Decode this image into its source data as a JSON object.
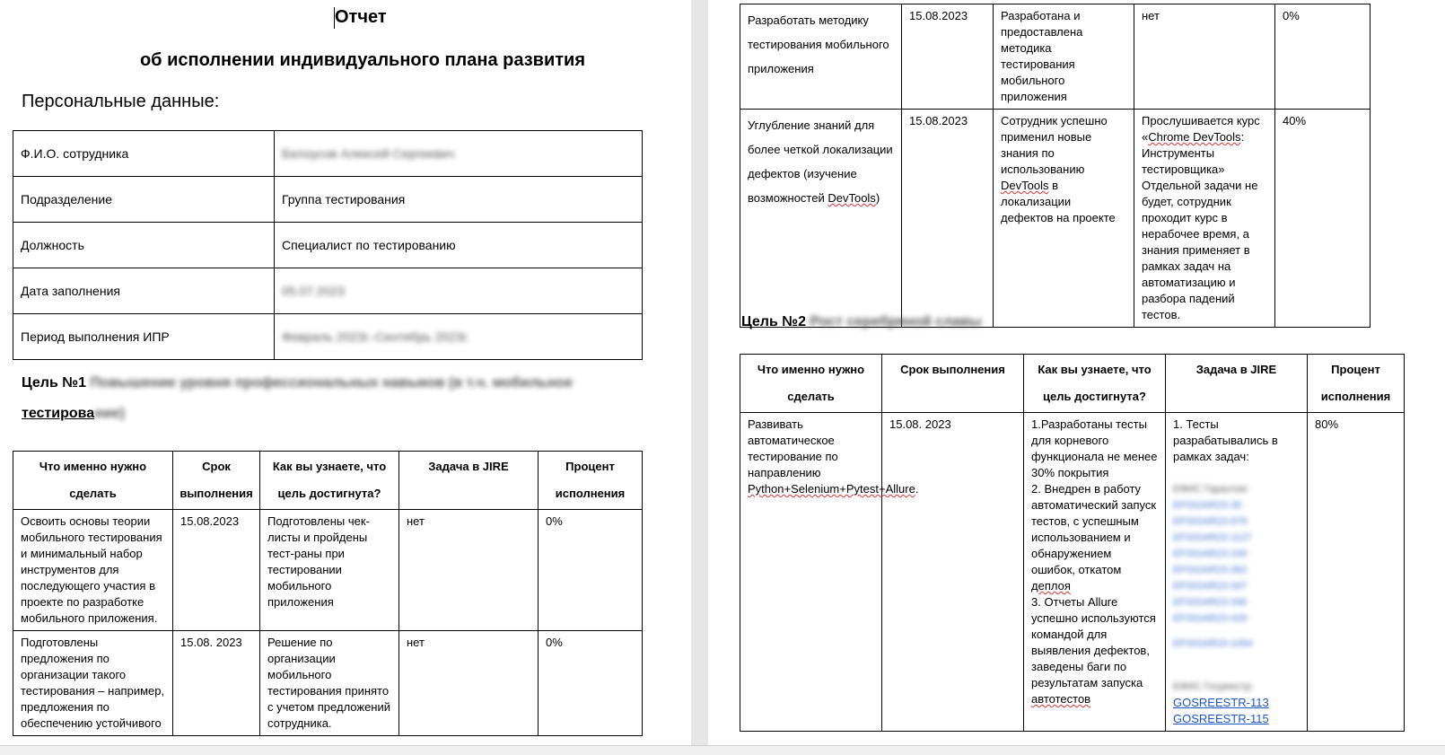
{
  "left": {
    "title": "Отчет",
    "subtitle": "об исполнении индивидуального плана развития",
    "personal_label": "Персональные данные:",
    "personal_rows": [
      {
        "label": "Ф.И.О. сотрудника",
        "value": "Белоусов Алексей Сергеевич"
      },
      {
        "label": "Подразделение",
        "value": "Группа тестирования"
      },
      {
        "label": "Должность",
        "value": "Специалист по тестированию"
      },
      {
        "label": "Дата заполнения",
        "value": "05.07.2023"
      },
      {
        "label": "Период выполнения ИПР",
        "value": "Февраль 2023г.-Сентябрь 2023г."
      }
    ],
    "goal1_prefix": "Цель №1",
    "goal1_blurred_a": "Повышение уровня профессиональных навыков (в т.ч. мобильное",
    "goal1_visible_tail": "тестирова",
    "goal1_blurred_b": "ние)",
    "headers": [
      "Что именно нужно сделать",
      "Срок выполнения",
      "Как вы узнаете, что цель достигнута?",
      "Задача в JIRE",
      "Процент исполнения"
    ],
    "rows": [
      {
        "what": "Освоить основы теории мобильного тестирования и минимальный набор инструментов для последующего участия в проекте по разработке мобильного приложения.",
        "deadline": "15.08.2023",
        "how": "Подготовлены чек-листы и пройдены тест-раны при тестировании мобильного приложения",
        "jira": "нет",
        "percent": "0%"
      },
      {
        "what": "Подготовлены предложения по организации такого тестирования – например, предложения по обеспечению устойчивого",
        "deadline": "15.08. 2023",
        "how": "Решение по организации мобильного тестирования принято с учетом предложений сотрудника.",
        "jira": "нет",
        "percent": "0%"
      }
    ]
  },
  "right": {
    "rows_top": [
      {
        "what": "Разработать методику тестирования мобильного приложения",
        "deadline": "15.08.2023",
        "how": "Разработана и предоставлена методика тестирования мобильного приложения",
        "jira": "нет",
        "percent": "0%"
      },
      {
        "what_a": "Углубление знаний для более четкой локализации дефектов (изучение возможностей ",
        "what_b": "DevTools",
        "what_c": ")",
        "deadline": "15.08.2023",
        "how_a": "Сотрудник успешно применил новые знания по использованию ",
        "how_b": "DevTools",
        "how_c": " в локализации дефектов на проекте",
        "jira_a": "Прослушивается курс «",
        "jira_b": "Chrome DevTools",
        "jira_c": ": Инструменты тестировщика» Отдельной задачи не будет, сотрудник проходит курс в нерабочее время, а знания применяет в рамках задач на автоматизацию и разбора падений тестов.",
        "percent": "40%"
      }
    ],
    "goal2_prefix": "Цель №2",
    "goal2_blurred": "Рост серебряной славы",
    "headers": [
      "Что именно нужно сделать",
      "Срок выполнения",
      "Как вы узнаете, что цель достигнута?",
      "Задача в JIRE",
      "Процент исполнения"
    ],
    "row": {
      "what_a": "Развивать автоматическое тестирование по направлению ",
      "what_b": "Python+Selenium+Pytest+Allure",
      "what_c": ".",
      "deadline": "15.08. 2023",
      "how_1": "1.Разработаны тесты для корневого функционала не менее 30% покрытия",
      "how_2": "2. Внедрен в работу автоматический запуск тестов, с успешным использованием и обнаружением ошибок, откатом ",
      "how_2b": "деплоя",
      "how_3": "3. Отчеты Allure успешно используются командой для выявления дефектов, заведены баги по результатам запуска ",
      "how_3b": "автотестов",
      "jira_intro": "1. Тесты разрабатывались в рамках задач:",
      "jira_group1": "ЕФИС Гарантия:",
      "jira_links1": [
        "EFISGAR23-30",
        "EFISGAR23-979",
        "EFISGAR23-1127",
        "EFISGAR23-249",
        "EFISGAR23-362",
        "EFISGAR23-347",
        "EFISGAR23-346",
        "EFISGAR23-429"
      ],
      "jira_link_extra": "EFISGAR23-1094",
      "jira_group2": "ЕФИС Госреестр:",
      "jira_links2": [
        "GOSREESTR-113",
        "GOSREESTR-115"
      ],
      "percent": "80%"
    }
  },
  "colors": {
    "background": "#e6e6e6",
    "page": "#ffffff",
    "link": "#1f58c4",
    "spellcheck": "#dd3333"
  }
}
